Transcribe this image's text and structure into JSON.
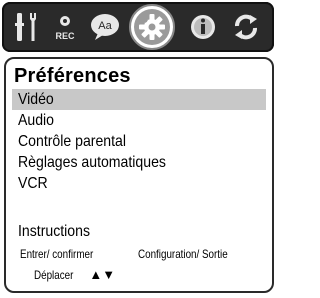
{
  "toolbar": {
    "icons": [
      {
        "name": "settings-tools-icon",
        "label": ""
      },
      {
        "name": "record-icon",
        "label": "REC"
      },
      {
        "name": "subtitle-icon",
        "label": "Aa"
      },
      {
        "name": "preferences-gear-icon",
        "label": ""
      },
      {
        "name": "info-icon",
        "label": ""
      },
      {
        "name": "refresh-icon",
        "label": ""
      }
    ],
    "selected_index": 3
  },
  "panel": {
    "title": "Préférences",
    "menu_items": [
      {
        "label": "Vidéo",
        "selected": true
      },
      {
        "label": "Audio",
        "selected": false
      },
      {
        "label": "Contrôle parental",
        "selected": false
      },
      {
        "label": "Règlages automatiques",
        "selected": false
      },
      {
        "label": "VCR",
        "selected": false
      }
    ],
    "instructions": {
      "title": "Instructions",
      "confirm": "Entrer/ confirmer",
      "setup_exit": "Configuration/ Sortie",
      "move": "Déplacer",
      "move_arrows": "▲▼"
    }
  },
  "colors": {
    "toolbar_bg": "#2a2a2a",
    "selected_row": "#c8c8c8",
    "panel_border": "#2a2a2a"
  }
}
